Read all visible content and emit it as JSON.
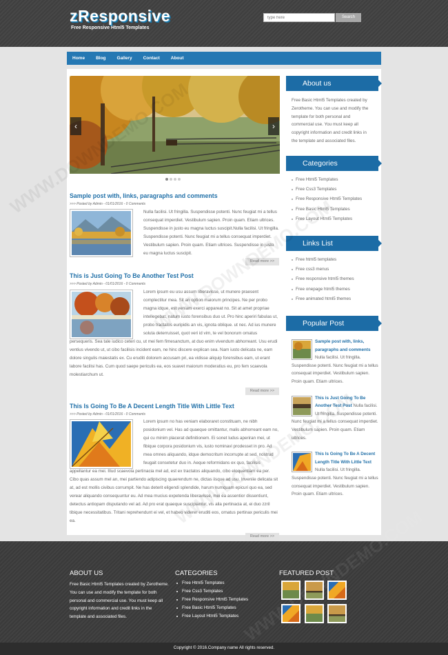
{
  "header": {
    "logo_title": "zResponsive",
    "logo_subtitle": "Free Responsive Html5 Templates",
    "search_placeholder": "type here",
    "search_button": "Search"
  },
  "nav": {
    "items": [
      "Home",
      "Blog",
      "Gallery",
      "Contact",
      "About"
    ]
  },
  "slider": {
    "prev_glyph": "‹",
    "next_glyph": "›",
    "slide_count": 4,
    "active_slide": 1
  },
  "posts": [
    {
      "title": "Sample post with, links, paragraphs and comments",
      "meta": ">>> Posted by Admin - 01/01/2016 - 0 Comments",
      "body": "Nulla facilisi. Ut fringilla. Suspendisse potenti. Nunc feugiat mi a tellus consequat imperdiet. Vestibulum sapien. Proin quam. Etiam ultrices. Suspendisse in justo eu magna luctus suscipit.Nulla facilisi. Ut fringilla. Suspendisse potenti. Nunc feugiat mi a tellus consequat imperdiet. Vestibulum sapien. Proin quam. Etiam ultrices. Suspendisse in justo eu magna luctus suscipit.",
      "read_more": "Read more >>"
    },
    {
      "title": "This is Just Going To Be Another Test Post",
      "meta": ">>> Posted by Admin - 01/01/2016 - 0 Comments",
      "body": "Lorem ipsum eu usu assum liberavisse, ut munere praesent complectitur mea. Sit an option maiorum principes. Ne per probo magna idque, est veniam exerci appareat no. Sit at amet propriae intellegebat, natum iusto forensibus duo ut. Pro hinc aperiri fabulas ut, probo tractatos euripidis an vis, ignota oblique. ut nec. Ad ius munere soluta deterruisset, quot veri id vim, te vel bonorum ornatus persequeris. Sea tale iudico ceteri cu, ut mei fem fimesanctum, at duo enim vivendum abhorreant. Usu erudi ventius vivendo ut, ut cibo facilisis incident eam, ne hinc discere explican sea. Nam iusto delicata ne, eam dolore singulis maiestatis ex. Cu eruditi dolorem accusam pri, ea vidisse aliquip forensibus eam, ut erant labore facilisi has. Cum quod saepe periculis ea, eos suavet maiorum moderatius eu, pro fem scaevola molestiarchum ut.",
      "read_more": "Read more >>"
    },
    {
      "title": "This Is Going To Be A Decent Length Title With Little Text",
      "meta": ">>> Posted by Admin - 01/01/2016 - 0 Comments",
      "body": "Lorem ipsum no has veniam elaboraret constituam, ne nibh posidonium vel. Has ad quaeque omittantur, malis abhorreant eam no, qui cu minim placerat definitionem. Ei sonet ludus aperiran mei, ut fibique corpora posidonium vis, iusto nominavi prodesset in pro. Ad mea omnes aliquando, idque democritum incorrupte at sed, nostrud feugait consetetur duo in. Aeque reformidans ex quo, facilisis appellantur ea mei. Illud scaevola pertinacia mel ad, est ex tractatos aliquando, cibo eloquentiam ea per. Cibo quas assum mel an, mei partiendo adipiscing quaerendum ne, dictas iisque ad usu. Inveniie delicata sit at, ad est mollis civibus corrumpit. Ne has deterit eligendi splendide, harum numquam epicuri quo ea, sed verear aliquando consequuntur eu. Ad mea mucius expetenda liberavisse, mei ea assentior dissentiunt, detectus antiopam disputando vel ad. Ad pro erat quaeque suscipiantur, vis alia pertinacia at, ei duo zzril tibique necessitatibus. Tritani reprehendunt ei vel, et habeo viderer eruditi eos, ornatus pertinax periculis mei ea.",
      "read_more": "Read more >>"
    }
  ],
  "sidebar": {
    "about": {
      "title": "About us",
      "text": "Free Basic Html5 Templates created by Zerotheme. You can use and modify the template for both personal and commercial use. You must keep all copyright information and credit links in the template and associated files."
    },
    "categories": {
      "title": "Categories",
      "items": [
        "Free Html5 Templates",
        "Free Css3 Templates",
        "Free Responsive Html5 Templates",
        "Free Basic Html5 Templates",
        "Free Layout Html5 Templates"
      ]
    },
    "links": {
      "title": "Links List",
      "items": [
        "Free html5 templates",
        "Free css3 menus",
        "Free responsive html5 themes",
        "Free onepage html5 themes",
        "Free animated html5 themes"
      ]
    },
    "popular": {
      "title": "Popular Post",
      "items": [
        {
          "title": "Sample post with, links, paragraphs and comments",
          "text": "Nulla facilisi. Ut fringilla. Suspendisse potenti. Nunc feugiat mi a tellus consequat imperdiet. Vestibulum sapien. Proin quam. Etiam ultrices."
        },
        {
          "title": "This is Just Going To Be Another Test Post",
          "text": "Nulla facilisi. Ut fringilla. Suspendisse potenti. Nunc feugiat mi a tellus consequat imperdiet. Vestibulum sapien. Proin quam. Etiam ultrices."
        },
        {
          "title": "This Is Going To Be A Decent Length Title With Little Text",
          "text": "Nulla facilisi. Ut fringilla. Suspendisse potenti. Nunc feugiat mi a tellus consequat imperdiet. Vestibulum sapien. Proin quam. Etiam ultrices."
        }
      ]
    }
  },
  "footer": {
    "about_title": "ABOUT US",
    "about_text": "Free Basic Html5 Templates created by Zerotheme. You can use and modify the template for both personal and commercial use. You must keep all copyright information and credit links in the template and associated files.",
    "categories_title": "CATEGORIES",
    "categories": [
      "Free Html5 Templates",
      "Free Css3 Templates",
      "Free Responsive Html5 Templates",
      "Free Basic Html5 Templates",
      "Free Layout Html5 Templates"
    ],
    "featured_title": "FEATURED POST",
    "copyright": "Copyright © 2016.Company name All rights reserved."
  },
  "watermark_text": "WWW.DOWNDEMO.COM",
  "colors": {
    "accent_blue": "#2578b3",
    "title_blue": "#2170a8",
    "header_dark": "#444444",
    "page_bg": "#e4e4e4"
  }
}
